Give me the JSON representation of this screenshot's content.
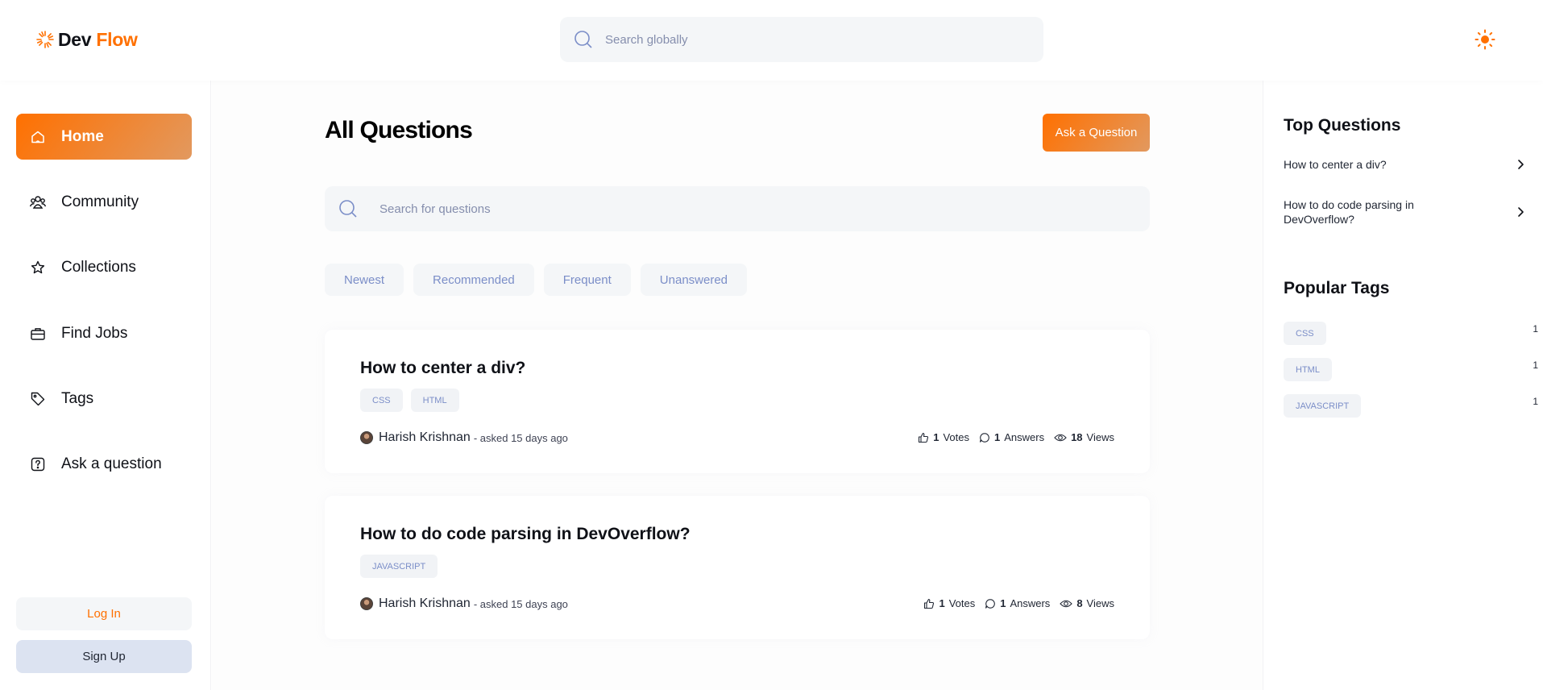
{
  "brand": {
    "name_part1": "Dev",
    "name_part2": "Flow",
    "accent": "#ff7000"
  },
  "header": {
    "search_placeholder": "Search globally",
    "theme_icon": "sun-icon"
  },
  "sidebar": {
    "items": [
      {
        "label": "Home",
        "icon": "home-icon",
        "active": true
      },
      {
        "label": "Community",
        "icon": "users-icon"
      },
      {
        "label": "Collections",
        "icon": "star-icon"
      },
      {
        "label": "Find Jobs",
        "icon": "briefcase-icon"
      },
      {
        "label": "Tags",
        "icon": "tag-icon"
      },
      {
        "label": "Ask a question",
        "icon": "question-icon"
      }
    ],
    "login_label": "Log In",
    "signup_label": "Sign Up"
  },
  "main": {
    "title": "All Questions",
    "ask_button": "Ask a Question",
    "search_placeholder": "Search for questions",
    "filters": [
      "Newest",
      "Recommended",
      "Frequent",
      "Unanswered"
    ],
    "questions": [
      {
        "title": "How to center a div?",
        "tags": [
          "CSS",
          "HTML"
        ],
        "author": "Harish Krishnan",
        "asked": "- asked 15 days ago",
        "votes_num": "1",
        "votes_label": "Votes",
        "answers_num": "1",
        "answers_label": "Answers",
        "views_num": "18",
        "views_label": "Views"
      },
      {
        "title": "How to do code parsing in DevOverflow?",
        "tags": [
          "JAVASCRIPT"
        ],
        "author": "Harish Krishnan",
        "asked": "- asked 15 days ago",
        "votes_num": "1",
        "votes_label": "Votes",
        "answers_num": "1",
        "answers_label": "Answers",
        "views_num": "8",
        "views_label": "Views"
      }
    ]
  },
  "right_sidebar": {
    "top_questions_title": "Top Questions",
    "top_questions": [
      "How to center a div?",
      "How to do code parsing in DevOverflow?"
    ],
    "popular_tags_title": "Popular Tags",
    "popular_tags": [
      {
        "name": "CSS",
        "count": "1"
      },
      {
        "name": "HTML",
        "count": "1"
      },
      {
        "name": "JAVASCRIPT",
        "count": "1"
      }
    ]
  }
}
